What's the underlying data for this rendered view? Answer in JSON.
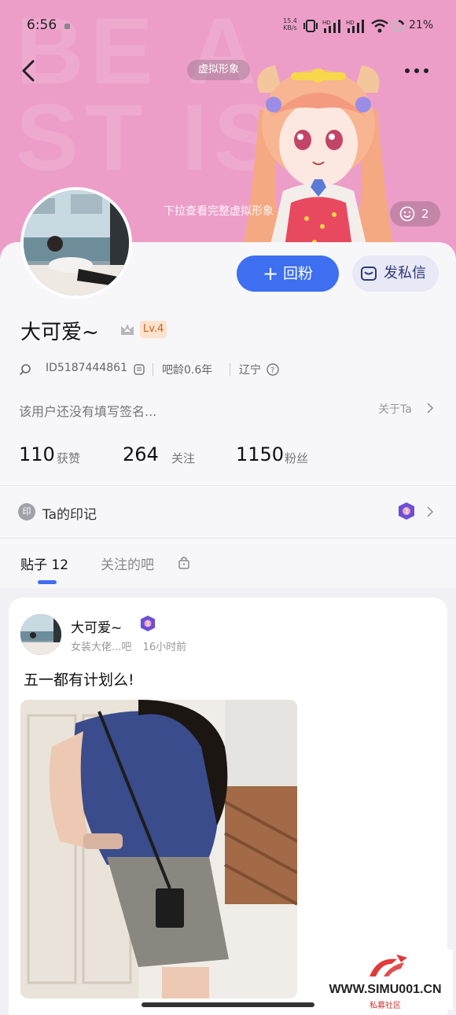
{
  "status_bar": {
    "time": "6:56",
    "net_speed_value": "15.4",
    "net_speed_unit": "KB/s",
    "battery": "21%"
  },
  "header": {
    "virtual_tag": "虚拟形象",
    "pull_hint": "下拉查看完整虚拟形象",
    "face_count": "2",
    "bg_color": "#ec9ec9"
  },
  "profile": {
    "follow_button": "回粉",
    "message_button": "发私信",
    "name": "大可爱~",
    "level": "Lv.4",
    "id": "ID5187444861",
    "tieba_age": "吧龄0.6年",
    "location": "辽宁",
    "signature": "该用户还没有填写签名...",
    "about": "关于Ta",
    "stats": [
      {
        "value": "110",
        "label": "获赞"
      },
      {
        "value": "264",
        "label": "关注"
      },
      {
        "value": "1150",
        "label": "粉丝"
      }
    ],
    "mark_icon": "印",
    "mark_title": "Ta的印记"
  },
  "tabs": {
    "posts": "贴子 12",
    "followed_bars": "关注的吧"
  },
  "post": {
    "author": "大可爱~",
    "source": "女装大佬...吧",
    "time": "16小时前",
    "text": "五一都有计划么!"
  },
  "watermark": {
    "url": "WWW.SIMU001.CN",
    "sub": "私募社区"
  },
  "colors": {
    "accent": "#3e6ff0",
    "header_pink": "#ec9ec9",
    "level_badge": "#fde2cc"
  }
}
